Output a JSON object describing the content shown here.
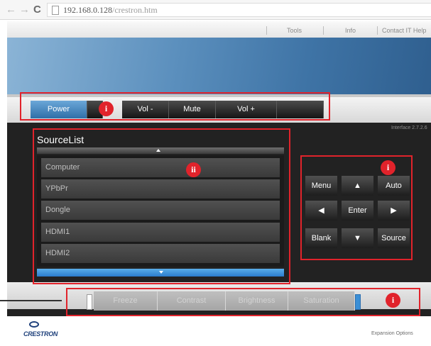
{
  "browser": {
    "url_host": "192.168.0.128",
    "url_path": "/crestron.htm",
    "icons": [
      "back-arrow-icon",
      "forward-arrow-icon",
      "reload-icon",
      "page-icon"
    ]
  },
  "header": {
    "links": [
      "Tools",
      "Info",
      "Contact IT Help"
    ]
  },
  "top_buttons": [
    {
      "label": "Power"
    },
    {
      "label": "Vol -"
    },
    {
      "label": "Mute"
    },
    {
      "label": "Vol +"
    }
  ],
  "interface_version": "Interface 2.7.2.6",
  "source_list": {
    "title": "SourceList",
    "items": [
      "Computer",
      "YPbPr",
      "Dongle",
      "HDMI1",
      "HDMI2"
    ]
  },
  "keypad": {
    "menu": "Menu",
    "auto": "Auto",
    "enter": "Enter",
    "blank": "Blank",
    "source": "Source",
    "up_icon": "up-arrow-icon",
    "down_icon": "down-arrow-icon",
    "left_icon": "left-arrow-icon",
    "right_icon": "right-arrow-icon"
  },
  "bottom_buttons": [
    "Freeze",
    "Contrast",
    "Brightness",
    "Saturation"
  ],
  "footer": {
    "logo": "CRESTRON",
    "expansion": "Expansion Options"
  },
  "annotations": {
    "power_bar": "i",
    "source_list": "ii",
    "keypad": "i",
    "bottom_bar": "i"
  },
  "colors": {
    "accent_blue": "#3a7fc0",
    "annotation_red": "#e1232b",
    "panel_dark": "#222222"
  }
}
